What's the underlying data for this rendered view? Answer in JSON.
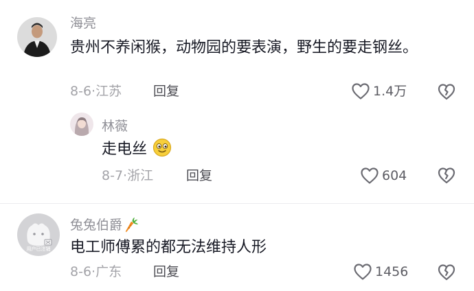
{
  "comments": [
    {
      "username": "海亮",
      "text": "贵州不养闲猴，动物园的要表演，野生的要走钢丝。",
      "date": "8-6",
      "location": "江苏",
      "reply_label": "回复",
      "likes": "1.4万",
      "avatar_icon": "person-photo-icon"
    },
    {
      "username": "林薇",
      "text": "走电丝",
      "emoji": "smiling-face-emoji",
      "date": "8-7",
      "location": "浙江",
      "reply_label": "回复",
      "likes": "604",
      "avatar_icon": "girl-photo-icon"
    },
    {
      "username": "兔兔伯爵",
      "username_emoji": "carrot-emoji",
      "text": "电工师傅累的都无法维持人形",
      "date": "8-6",
      "location": "广东",
      "reply_label": "回复",
      "likes": "1456",
      "avatar_icon": "deactivated-user-avatar-icon",
      "avatar_label": "用户已注销"
    }
  ],
  "separator": "·",
  "colors": {
    "text": "#161823",
    "username": "#8f8f96",
    "meta": "#a3a3a8",
    "icon": "#6b6b72"
  }
}
